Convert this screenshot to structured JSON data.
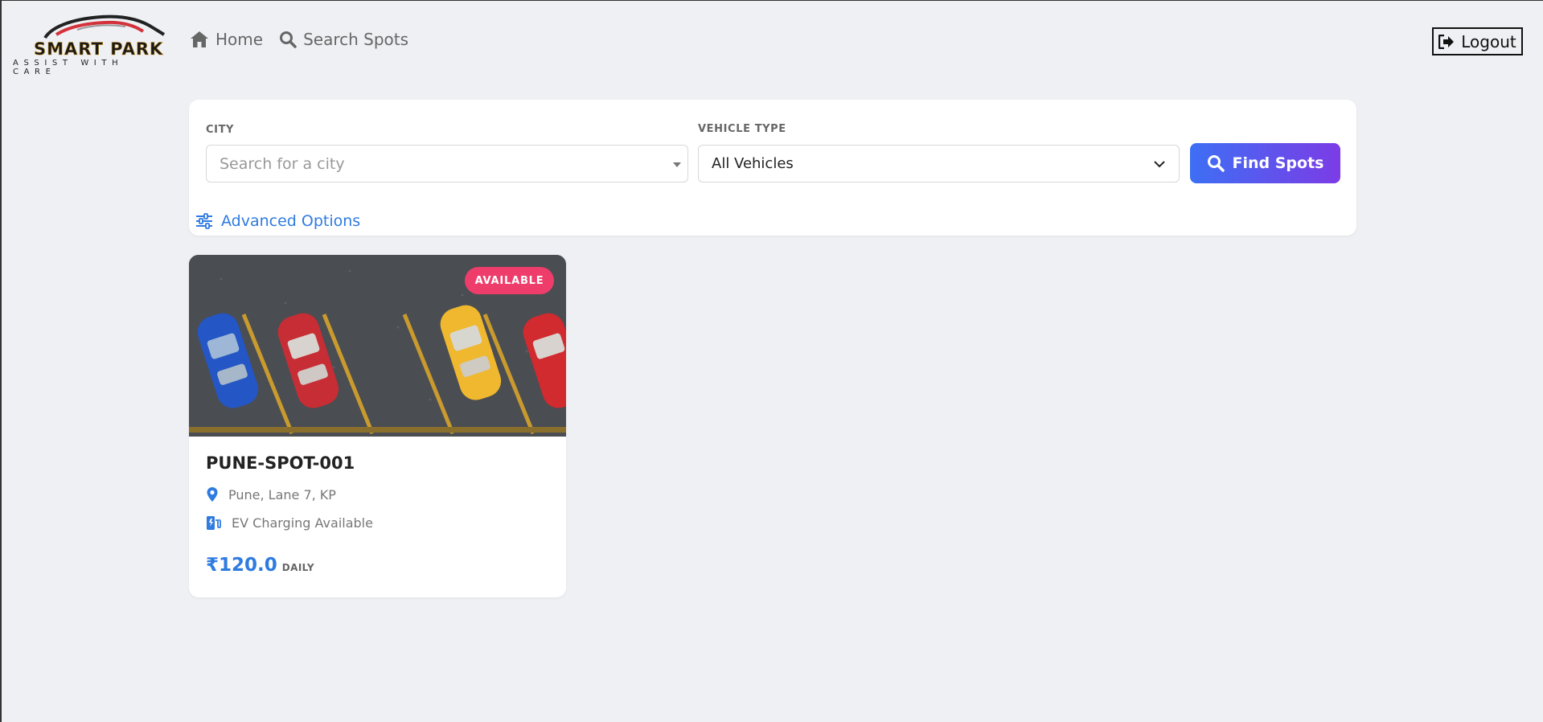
{
  "brand": {
    "name": "SMART PARK",
    "tagline": "ASSIST WITH CARE"
  },
  "nav": {
    "home_label": "Home",
    "search_label": "Search Spots"
  },
  "header": {
    "logout_label": "Logout"
  },
  "search": {
    "city_label": "CITY",
    "city_placeholder": "Search for a city",
    "vehicle_label": "VEHICLE TYPE",
    "vehicle_value": "All Vehicles",
    "find_label": "Find Spots",
    "advanced_label": "Advanced Options"
  },
  "spots": [
    {
      "status": "AVAILABLE",
      "title": "PUNE-SPOT-001",
      "location": "Pune, Lane 7, KP",
      "feature": "EV Charging Available",
      "price": "₹120.0",
      "period": "DAILY"
    }
  ],
  "colors": {
    "accent": "#2f7be0",
    "badge": "#ee3d6b",
    "button_start": "#3d6ff4",
    "button_end": "#7c3ce6",
    "background": "#eff0f4"
  }
}
